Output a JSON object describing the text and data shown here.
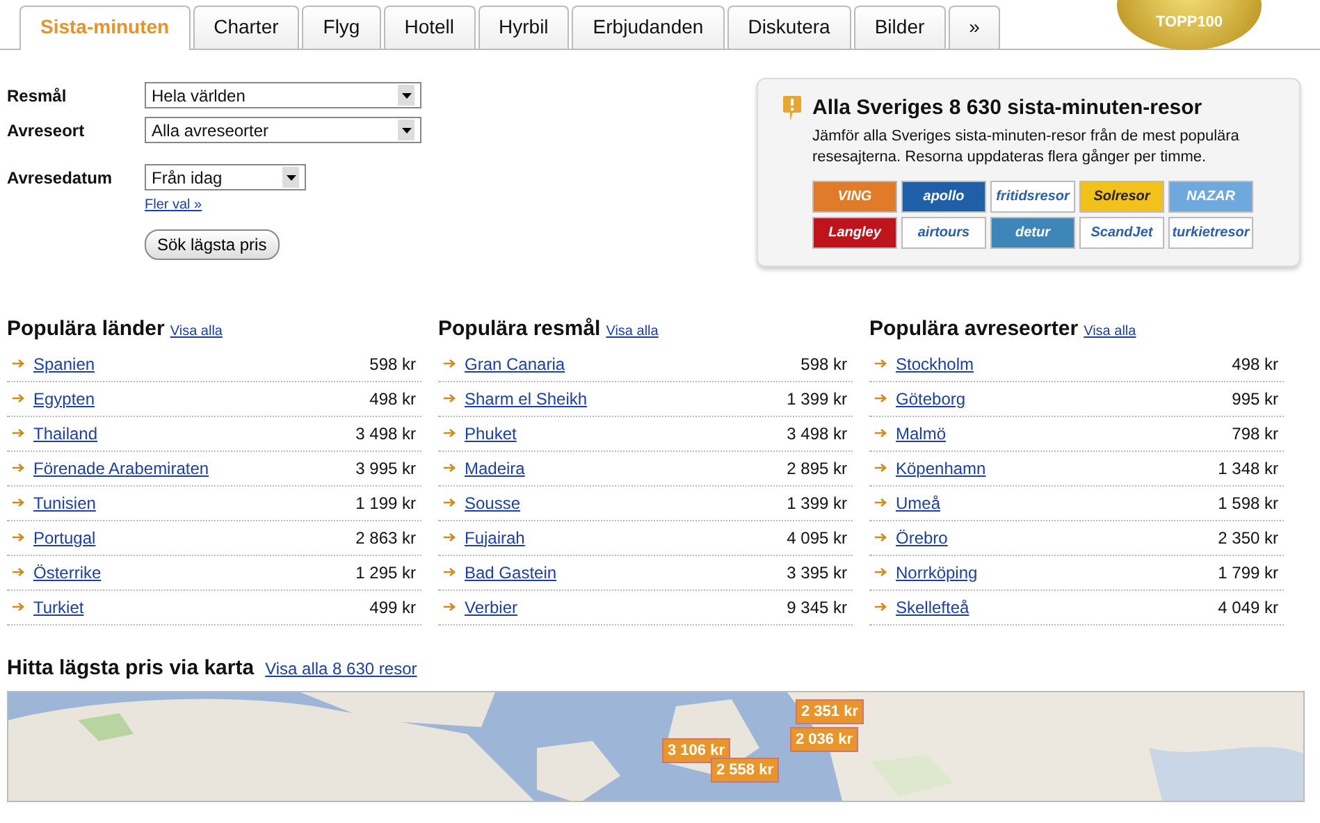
{
  "tabs": [
    {
      "label": "Sista-minuten",
      "selected": true
    },
    {
      "label": "Charter",
      "selected": false
    },
    {
      "label": "Flyg",
      "selected": false
    },
    {
      "label": "Hotell",
      "selected": false
    },
    {
      "label": "Hyrbil",
      "selected": false
    },
    {
      "label": "Erbjudanden",
      "selected": false
    },
    {
      "label": "Diskutera",
      "selected": false
    },
    {
      "label": "Bilder",
      "selected": false
    },
    {
      "label": "»",
      "selected": false
    }
  ],
  "badge": "TOPP100",
  "search_form": {
    "fields": [
      {
        "label": "Resmål",
        "value": "Hela världen"
      },
      {
        "label": "Avreseort",
        "value": "Alla avreseorter"
      },
      {
        "label": "Avresedatum",
        "value": "Från idag"
      }
    ],
    "more_link": "Fler val »",
    "submit": "Sök lägsta pris"
  },
  "info_box": {
    "title": "Alla Sveriges 8 630 sista-minuten-resor",
    "text": "Jämför alla Sveriges sista-minuten-resor från de mest populära resesajterna. Resorna uppdateras flera gånger per timme.",
    "logos": [
      {
        "label": "VING",
        "color": "#e07b2a"
      },
      {
        "label": "apollo",
        "color": "#1f5fa8"
      },
      {
        "label": "fritidsresor",
        "color": "#ffffff"
      },
      {
        "label": "Solresor",
        "color": "#f2c21b"
      },
      {
        "label": "NAZAR",
        "color": "#6fa8dc"
      },
      {
        "label": "Langley",
        "color": "#c0141c"
      },
      {
        "label": "airtours",
        "color": "#ffffff"
      },
      {
        "label": "detur",
        "color": "#3f86b8"
      },
      {
        "label": "ScandJet",
        "color": "#ffffff"
      },
      {
        "label": "turkietresor",
        "color": "#ffffff"
      }
    ]
  },
  "lists": [
    {
      "title": "Populära länder",
      "link": "Visa alla",
      "rows": [
        {
          "name": "Spanien",
          "price": "598 kr"
        },
        {
          "name": "Egypten",
          "price": "498 kr"
        },
        {
          "name": "Thailand",
          "price": "3 498 kr"
        },
        {
          "name": "Förenade Arabemiraten",
          "price": "3 995 kr"
        },
        {
          "name": "Tunisien",
          "price": "1 199 kr"
        },
        {
          "name": "Portugal",
          "price": "2 863 kr"
        },
        {
          "name": "Österrike",
          "price": "1 295 kr"
        },
        {
          "name": "Turkiet",
          "price": "499 kr"
        }
      ]
    },
    {
      "title": "Populära resmål",
      "link": "Visa alla",
      "rows": [
        {
          "name": "Gran Canaria",
          "price": "598 kr"
        },
        {
          "name": "Sharm el Sheikh",
          "price": "1 399 kr"
        },
        {
          "name": "Phuket",
          "price": "3 498 kr"
        },
        {
          "name": "Madeira",
          "price": "2 895 kr"
        },
        {
          "name": "Sousse",
          "price": "1 399 kr"
        },
        {
          "name": "Fujairah",
          "price": "4 095 kr"
        },
        {
          "name": "Bad Gastein",
          "price": "3 395 kr"
        },
        {
          "name": "Verbier",
          "price": "9 345 kr"
        }
      ]
    },
    {
      "title": "Populära avreseorter",
      "link": "Visa alla",
      "rows": [
        {
          "name": "Stockholm",
          "price": "498 kr"
        },
        {
          "name": "Göteborg",
          "price": "995 kr"
        },
        {
          "name": "Malmö",
          "price": "798 kr"
        },
        {
          "name": "Köpenhamn",
          "price": "1 348 kr"
        },
        {
          "name": "Umeå",
          "price": "1 598 kr"
        },
        {
          "name": "Örebro",
          "price": "2 350 kr"
        },
        {
          "name": "Norrköping",
          "price": "1 799 kr"
        },
        {
          "name": "Skellefteå",
          "price": "4 049 kr"
        }
      ]
    }
  ],
  "map": {
    "title": "Hitta lägsta pris via karta",
    "link": "Visa alla 8 630 resor",
    "markers": [
      {
        "label": "2 351 kr"
      },
      {
        "label": "2 036 kr"
      },
      {
        "label": "3 106 kr"
      },
      {
        "label": "2 558 kr"
      }
    ]
  }
}
